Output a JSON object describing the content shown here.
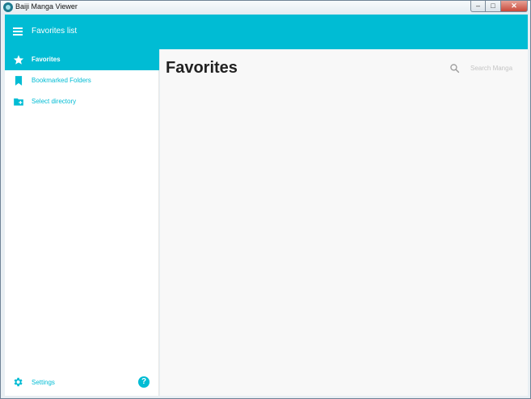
{
  "window": {
    "title": "Baiji Manga Viewer"
  },
  "appbar": {
    "title": "Favorites list"
  },
  "sidebar": {
    "items": [
      {
        "label": "Favorites",
        "icon": "star-icon",
        "active": true
      },
      {
        "label": "Bookmarked Folders",
        "icon": "bookmark-icon",
        "active": false
      },
      {
        "label": "Select directory",
        "icon": "folder-add-icon",
        "active": false
      }
    ],
    "settings_label": "Settings"
  },
  "main": {
    "page_title": "Favorites",
    "search": {
      "placeholder": "Search Manga",
      "value": ""
    }
  },
  "colors": {
    "accent": "#00bcd4",
    "content_bg": "#f8f8f8",
    "sidebar_bg": "#ffffff"
  }
}
